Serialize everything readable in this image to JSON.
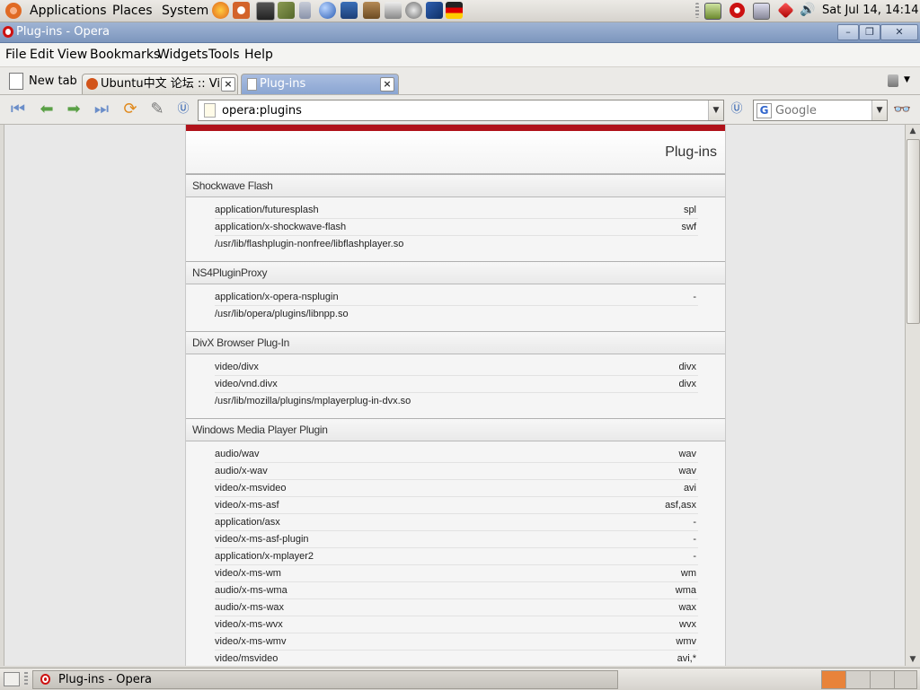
{
  "panel": {
    "menus": [
      "Applications",
      "Places",
      "System"
    ],
    "clock": "Sat Jul 14, 14:14"
  },
  "window": {
    "title": "Plug-ins - Opera"
  },
  "menubar": [
    "File",
    "Edit",
    "View",
    "Bookmarks",
    "Widgets",
    "Tools",
    "Help"
  ],
  "tabs": {
    "new_tab": "New tab",
    "items": [
      {
        "label": "Ubuntu中文 论坛 :: Vi...",
        "active": false
      },
      {
        "label": "Plug-ins",
        "active": true
      }
    ]
  },
  "address": {
    "value": "opera:plugins"
  },
  "search": {
    "placeholder": "Google"
  },
  "page": {
    "title": "Plug-ins",
    "plugins": [
      {
        "name": "Shockwave Flash",
        "mimes": [
          {
            "type": "application/futuresplash",
            "ext": "spl"
          },
          {
            "type": "application/x-shockwave-flash",
            "ext": "swf"
          }
        ],
        "path": "/usr/lib/flashplugin-nonfree/libflashplayer.so"
      },
      {
        "name": "NS4PluginProxy",
        "mimes": [
          {
            "type": "application/x-opera-nsplugin",
            "ext": "-"
          }
        ],
        "path": "/usr/lib/opera/plugins/libnpp.so"
      },
      {
        "name": "DivX Browser Plug-In",
        "mimes": [
          {
            "type": "video/divx",
            "ext": "divx"
          },
          {
            "type": "video/vnd.divx",
            "ext": "divx"
          }
        ],
        "path": "/usr/lib/mozilla/plugins/mplayerplug-in-dvx.so"
      },
      {
        "name": "Windows Media Player Plugin",
        "mimes": [
          {
            "type": "audio/wav",
            "ext": "wav"
          },
          {
            "type": "audio/x-wav",
            "ext": "wav"
          },
          {
            "type": "video/x-msvideo",
            "ext": "avi"
          },
          {
            "type": "video/x-ms-asf",
            "ext": "asf,asx"
          },
          {
            "type": "application/asx",
            "ext": "-"
          },
          {
            "type": "video/x-ms-asf-plugin",
            "ext": "-"
          },
          {
            "type": "application/x-mplayer2",
            "ext": "-"
          },
          {
            "type": "video/x-ms-wm",
            "ext": "wm"
          },
          {
            "type": "audio/x-ms-wma",
            "ext": "wma"
          },
          {
            "type": "audio/x-ms-wax",
            "ext": "wax"
          },
          {
            "type": "video/x-ms-wvx",
            "ext": "wvx"
          },
          {
            "type": "video/x-ms-wmv",
            "ext": "wmv"
          },
          {
            "type": "video/msvideo",
            "ext": "avi,*"
          }
        ],
        "path": ""
      }
    ]
  },
  "taskbar": {
    "window_label": "Plug-ins - Opera"
  }
}
